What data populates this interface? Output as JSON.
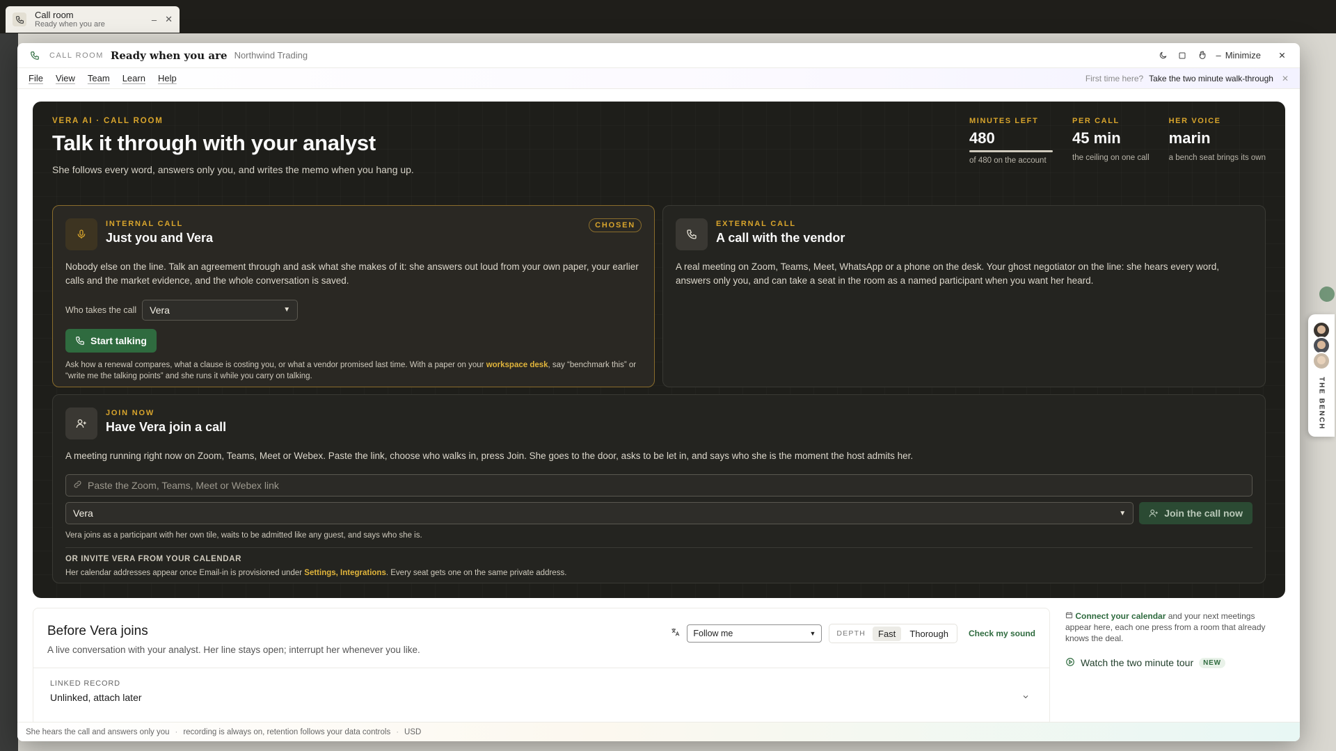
{
  "taskbar": {
    "title": "Call room",
    "subtitle": "Ready when you are"
  },
  "titlebar": {
    "kicker": "CALL ROOM",
    "title": "Ready when you are",
    "org": "Northwind Trading",
    "minimize_label": "Minimize"
  },
  "menu": {
    "items": [
      "File",
      "View",
      "Team",
      "Learn",
      "Help"
    ],
    "first_time": "First time here?",
    "walkthrough": "Take the two minute walk-through"
  },
  "hero": {
    "eyebrow": "VERA AI · CALL ROOM",
    "title": "Talk it through with your analyst",
    "subtitle": "She follows every word, answers only you, and writes the memo when you hang up.",
    "stats": [
      {
        "label": "MINUTES LEFT",
        "value": "480",
        "note": "of 480 on the account",
        "fraction": 1.0
      },
      {
        "label": "PER CALL",
        "value": "45 min",
        "note": "the ceiling on one call"
      },
      {
        "label": "HER VOICE",
        "value": "marin",
        "note": "a bench seat brings its own"
      }
    ]
  },
  "internal": {
    "kicker": "INTERNAL CALL",
    "title": "Just you and Vera",
    "chosen": "CHOSEN",
    "body": "Nobody else on the line. Talk an agreement through and ask what she makes of it: she answers out loud from your own paper, your earlier calls and the market evidence, and the whole conversation is saved.",
    "who_label": "Who takes the call",
    "who_value": "Vera",
    "start_label": "Start talking",
    "note_pre": "Ask how a renewal compares, what a clause is costing you, or what a vendor promised last time. With a paper on your ",
    "note_link": "workspace desk",
    "note_post": ", say “benchmark this” or “write me the talking points” and she runs it while you carry on talking."
  },
  "external": {
    "kicker": "EXTERNAL CALL",
    "title": "A call with the vendor",
    "body": "A real meeting on Zoom, Teams, Meet, WhatsApp or a phone on the desk. Your ghost negotiator on the line: she hears every word, answers only you, and can take a seat in the room as a named participant when you want her heard."
  },
  "join": {
    "kicker": "JOIN NOW",
    "title": "Have Vera join a call",
    "body": "A meeting running right now on Zoom, Teams, Meet or Webex. Paste the link, choose who walks in, press Join. She goes to the door, asks to be let in, and says who she is the moment the host admits her.",
    "placeholder": "Paste the Zoom, Teams, Meet or Webex link",
    "who_value": "Vera",
    "join_label": "Join the call now",
    "note": "Vera joins as a participant with her own tile, waits to be admitted like any guest, and says who she is.",
    "or_head": "OR INVITE VERA FROM YOUR CALENDAR",
    "cal_pre": "Her calendar addresses appear once Email-in is provisioned under ",
    "cal_link": "Settings, Integrations",
    "cal_post": ". Every seat gets one on the same private address."
  },
  "before": {
    "title": "Before Vera joins",
    "subtitle": "A live conversation with your analyst. Her line stays open; interrupt her whenever you like.",
    "language_value": "Follow me",
    "depth_label": "DEPTH",
    "depth_options": [
      "Fast",
      "Thorough"
    ],
    "depth_selected": "Fast",
    "check_sound": "Check my sound",
    "linked_label": "LINKED RECORD",
    "linked_value": "Unlinked, attach later"
  },
  "side": {
    "connect": "Connect your calendar",
    "connect_rest": " and your next meetings appear here, each one press from a room that already knows the deal.",
    "tour": "Watch the two minute tour",
    "new_badge": "NEW"
  },
  "status": {
    "items": [
      "She hears the call and answers only you",
      "recording is always on, retention follows your data controls",
      "USD"
    ]
  },
  "bench": {
    "label": "THE BENCH"
  },
  "colors": {
    "gold": "#d9a52c",
    "green": "#2f6b3f",
    "dark": "#1e1e1a"
  }
}
